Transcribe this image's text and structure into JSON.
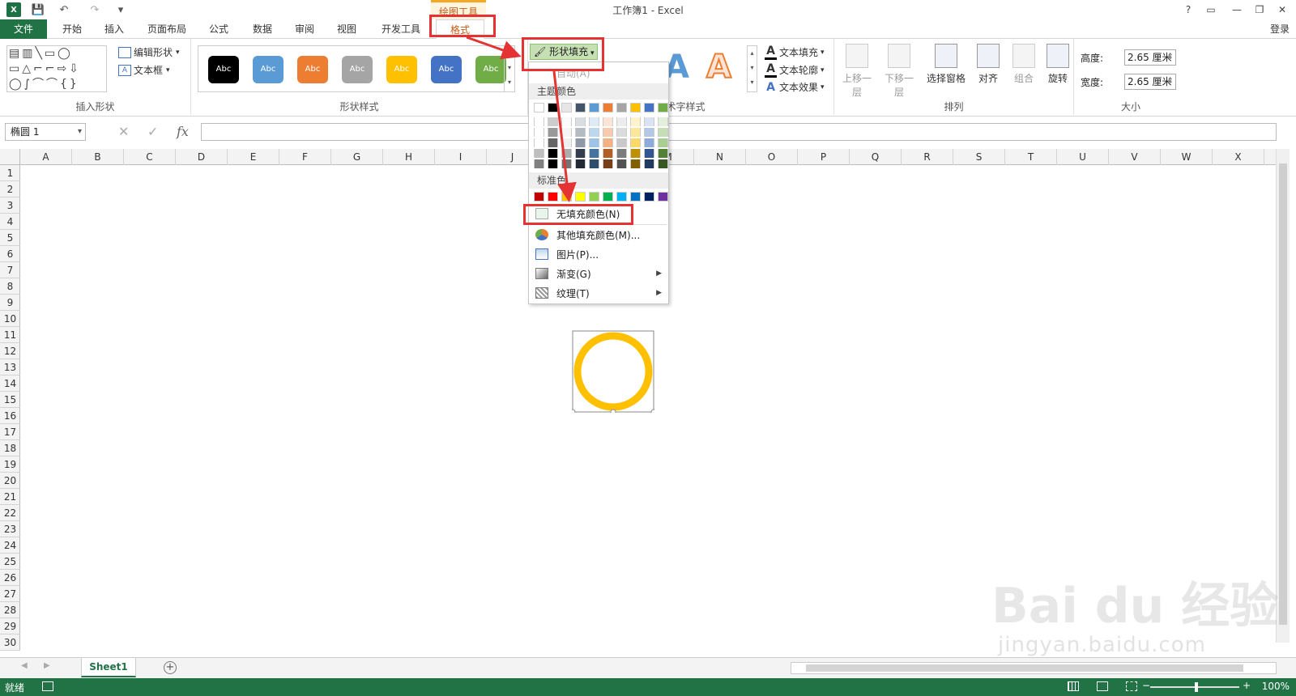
{
  "title_bar": {
    "window_title": "工作簿1 - Excel",
    "contextual_tab_group": "绘图工具",
    "excel_logo": "X",
    "buttons": {
      "help": "?",
      "ribbon_options": "▭",
      "minimize": "—",
      "restore": "❐",
      "close": "✕"
    },
    "qat": {
      "save": "💾",
      "undo": "↶",
      "redo": "↷",
      "customize": "▾"
    }
  },
  "tabs": [
    "文件",
    "开始",
    "插入",
    "页面布局",
    "公式",
    "数据",
    "审阅",
    "视图",
    "开发工具",
    "格式"
  ],
  "login_label": "登录",
  "ribbon": {
    "insert_shapes": {
      "label": "插入形状",
      "edit_shape": "编辑形状",
      "text_box": "文本框",
      "shape_rows": [
        "▤▥╲▭◯",
        "▭△⌐⌐⇨⇩",
        "◯∫⌒⌒{}"
      ]
    },
    "shape_styles": {
      "label": "形状样式",
      "swatches": [
        {
          "text": "Abc",
          "color": "#000000"
        },
        {
          "text": "Abc",
          "color": "#5b9bd5"
        },
        {
          "text": "Abc",
          "color": "#ed7d31"
        },
        {
          "text": "Abc",
          "color": "#a5a5a5"
        },
        {
          "text": "Abc",
          "color": "#ffc000"
        },
        {
          "text": "Abc",
          "color": "#4472c4"
        },
        {
          "text": "Abc",
          "color": "#70ad47"
        }
      ]
    },
    "shape_fill_button": "形状填充",
    "wordart": {
      "label": "艺术字样式",
      "text_fill": "文本填充",
      "text_outline": "文本轮廓",
      "text_effects": "文本效果",
      "sample_a": "A"
    },
    "arrange": {
      "label": "排列",
      "bring_forward": "上移一层",
      "send_backward": "下移一层",
      "selection_pane": "选择窗格",
      "align": "对齐",
      "group": "组合",
      "rotate": "旋转"
    },
    "size": {
      "label": "大小",
      "height_label": "高度:",
      "height_value": "2.65 厘米",
      "width_label": "宽度:",
      "width_value": "2.65 厘米"
    }
  },
  "formula_bar": {
    "name_box": "椭圆 1",
    "cancel": "✕",
    "enter": "✓",
    "fx": "fx",
    "value": ""
  },
  "columns": [
    "A",
    "B",
    "C",
    "D",
    "E",
    "F",
    "G",
    "H",
    "I",
    "J",
    "K",
    "L",
    "M",
    "N",
    "O",
    "P",
    "Q",
    "R",
    "S",
    "T",
    "U",
    "V",
    "W",
    "X"
  ],
  "rows": [
    "1",
    "2",
    "3",
    "4",
    "5",
    "6",
    "7",
    "8",
    "9",
    "10",
    "11",
    "12",
    "13",
    "14",
    "15",
    "16",
    "17",
    "18",
    "19",
    "20",
    "21",
    "22",
    "23",
    "24",
    "25",
    "26",
    "27",
    "28",
    "29",
    "30"
  ],
  "fill_menu": {
    "auto": "自动(A)",
    "theme_colors_header": "主题颜色",
    "standard_colors_header": "标准色",
    "theme_colors_top": [
      "#ffffff",
      "#000000",
      "#e7e6e6",
      "#44546a",
      "#5b9bd5",
      "#ed7d31",
      "#a5a5a5",
      "#ffc000",
      "#4472c4",
      "#70ad47"
    ],
    "standard_colors": [
      "#c00000",
      "#ff0000",
      "#ffc000",
      "#ffff00",
      "#92d050",
      "#00b050",
      "#00b0f0",
      "#0070c0",
      "#002060",
      "#7030a0"
    ],
    "no_fill": "无填充颜色(N)",
    "more_colors": "其他填充颜色(M)...",
    "picture": "图片(P)...",
    "gradient": "渐变(G)",
    "texture": "纹理(T)",
    "submenu_arrow": "▶"
  },
  "sheet_tabs": [
    "Sheet1"
  ],
  "add_sheet": "+",
  "status_bar": {
    "ready": "就绪",
    "zoom": "100%"
  },
  "watermark": {
    "text": "Bai du 经验",
    "sub": "jingyan.baidu.com"
  },
  "colors": {
    "excel_green": "#217346",
    "annotation_red": "#e53333",
    "circle_stroke": "#ffc000"
  }
}
